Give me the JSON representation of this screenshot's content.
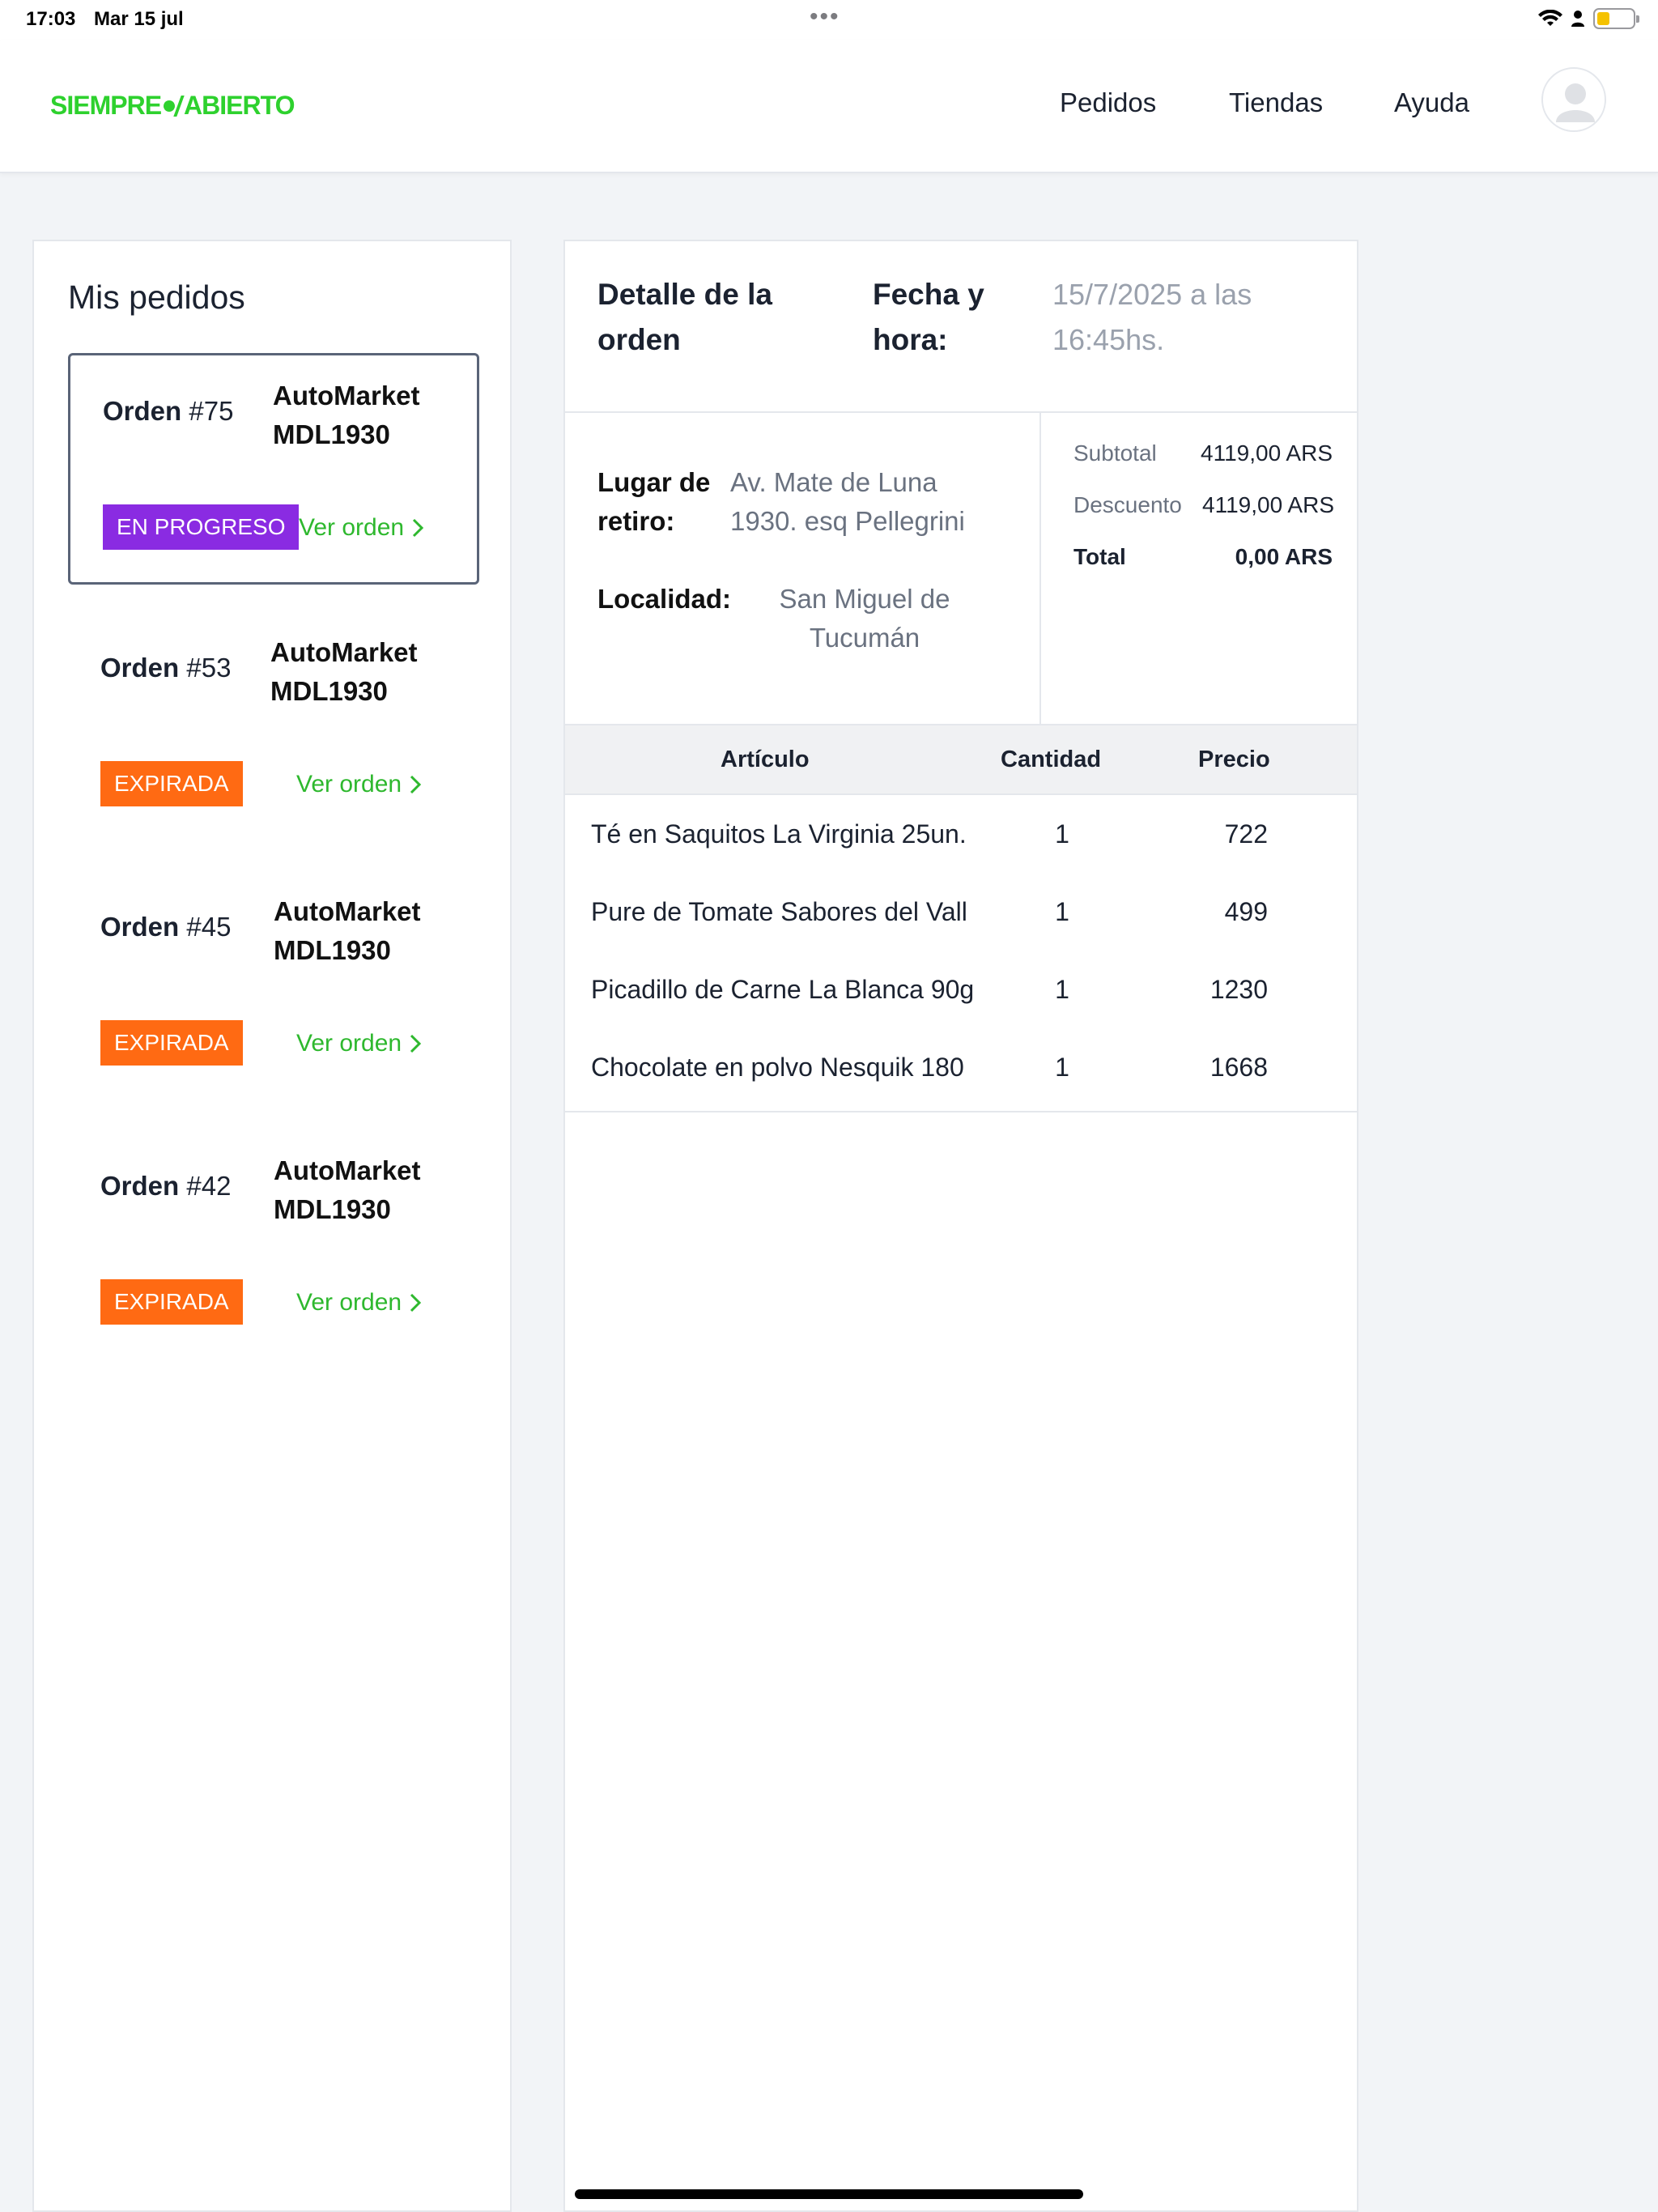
{
  "status_bar": {
    "time": "17:03",
    "date": "Mar 15 jul",
    "dots": "•••",
    "battery_level": 0.35,
    "battery_color": "#f5c200"
  },
  "header": {
    "logo_left": "SIEMPRE",
    "logo_right": "ABIERTO",
    "logo_color": "#2ed12e",
    "nav": [
      "Pedidos",
      "Tiendas",
      "Ayuda"
    ],
    "avatar_icon": "user-avatar-icon"
  },
  "orders_panel": {
    "title": "Mis pedidos",
    "orders": [
      {
        "label": "Orden",
        "number": "#75",
        "store": "AutoMarket MDL1930",
        "status": "EN PROGRESO",
        "status_color": "#8a2be2",
        "link": "Ver orden",
        "selected": true
      },
      {
        "label": "Orden",
        "number": "#53",
        "store": "AutoMarket MDL1930",
        "status": "EXPIRADA",
        "status_color": "#ff6a13",
        "link": "Ver orden",
        "selected": false
      },
      {
        "label": "Orden",
        "number": "#45",
        "store": "AutoMarket MDL1930",
        "status": "EXPIRADA",
        "status_color": "#ff6a13",
        "link": "Ver orden",
        "selected": false
      },
      {
        "label": "Orden",
        "number": "#42",
        "store": "AutoMarket MDL1930",
        "status": "EXPIRADA",
        "status_color": "#ff6a13",
        "link": "Ver orden",
        "selected": false
      }
    ]
  },
  "detail": {
    "title": "Detalle de la orden",
    "date_label": "Fecha y hora:",
    "date_value": "15/7/2025 a las 16:45hs.",
    "pickup_label": "Lugar de retiro:",
    "pickup_value": "Av. Mate de Luna 1930. esq Pellegrini",
    "locality_label": "Localidad:",
    "locality_value": "San Miguel de Tucumán",
    "summary": {
      "subtotal_label": "Subtotal",
      "subtotal_value": "4119,00 ARS",
      "discount_label": "Descuento",
      "discount_value": "4119,00 ARS",
      "total_label": "Total",
      "total_value": "0,00 ARS"
    },
    "table": {
      "headers": [
        "Artículo",
        "Cantidad",
        "Precio"
      ],
      "rows": [
        {
          "item": "Té en Saquitos La Virginia 25un.",
          "qty": "1",
          "price": "722"
        },
        {
          "item": "Pure de Tomate Sabores del Vall",
          "qty": "1",
          "price": "499"
        },
        {
          "item": "Picadillo de Carne La Blanca 90g",
          "qty": "1",
          "price": "1230"
        },
        {
          "item": "Chocolate en polvo Nesquik 180",
          "qty": "1",
          "price": "1668"
        }
      ]
    }
  }
}
